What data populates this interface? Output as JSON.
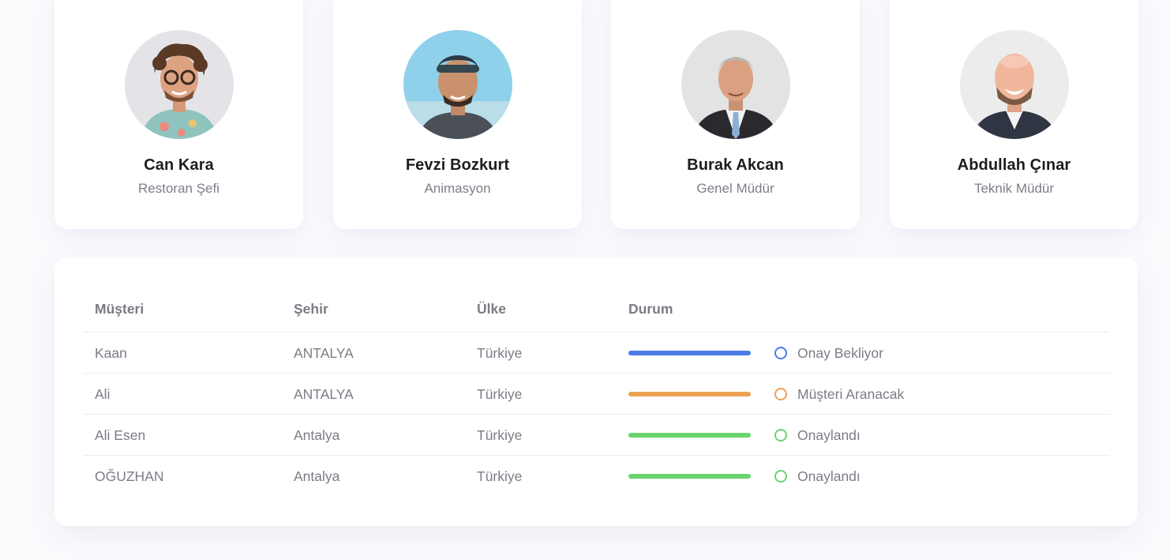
{
  "team": [
    {
      "name": "Can Kara",
      "role": "Restoran Şefi",
      "photo": "curly-hair-glasses-man-photo"
    },
    {
      "name": "Fevzi Bozkurt",
      "role": "Animasyon",
      "photo": "beanie-man-photo"
    },
    {
      "name": "Burak Akcan",
      "role": "Genel Müdür",
      "photo": "suit-tie-man-photo"
    },
    {
      "name": "Abdullah Çınar",
      "role": "Teknik Müdür",
      "photo": "bald-bearded-man-photo"
    }
  ],
  "table": {
    "headers": {
      "customer": "Müşteri",
      "city": "Şehir",
      "country": "Ülke",
      "status": "Durum"
    },
    "rows": [
      {
        "customer": "Kaan",
        "city": "ANTALYA",
        "country": "Türkiye",
        "status": "Onay Bekliyor",
        "color": "#4c7be8"
      },
      {
        "customer": "Ali",
        "city": "ANTALYA",
        "country": "Türkiye",
        "status": "Müşteri Aranacak",
        "color": "#eda353"
      },
      {
        "customer": "Ali Esen",
        "city": "Antalya",
        "country": "Türkiye",
        "status": "Onaylandı",
        "color": "#6bd36e"
      },
      {
        "customer": "OĞUZHAN",
        "city": "Antalya",
        "country": "Türkiye",
        "status": "Onaylandı",
        "color": "#6bd36e"
      }
    ]
  }
}
